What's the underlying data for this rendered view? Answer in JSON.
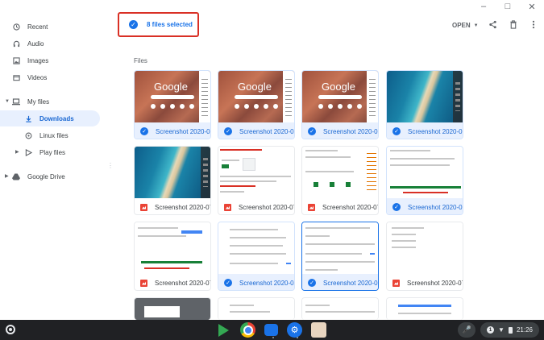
{
  "window": {
    "minimize": "–",
    "maximize": "□",
    "close": "✕"
  },
  "sidebar": {
    "items": [
      {
        "label": "Recent",
        "icon": "clock-icon"
      },
      {
        "label": "Audio",
        "icon": "headphones-icon"
      },
      {
        "label": "Images",
        "icon": "image-icon"
      },
      {
        "label": "Videos",
        "icon": "video-icon"
      },
      {
        "label": "My files",
        "icon": "laptop-icon"
      },
      {
        "label": "Downloads",
        "icon": "download-icon",
        "active": true
      },
      {
        "label": "Linux files",
        "icon": "linux-icon"
      },
      {
        "label": "Play files",
        "icon": "play-icon"
      },
      {
        "label": "Google Drive",
        "icon": "drive-icon"
      }
    ]
  },
  "header": {
    "selection_text": "8 files selected",
    "open_label": "OPEN",
    "accent": "#1a73e8",
    "highlight": "#d93025"
  },
  "section": {
    "title": "Files"
  },
  "files": [
    {
      "name": "Screenshot 2020-07...",
      "selected": true
    },
    {
      "name": "Screenshot 2020-07...",
      "selected": true
    },
    {
      "name": "Screenshot 2020-07...",
      "selected": true
    },
    {
      "name": "Screenshot 2020-07...",
      "selected": true
    },
    {
      "name": "Screenshot 2020-07...",
      "selected": false
    },
    {
      "name": "Screenshot 2020-07...",
      "selected": false
    },
    {
      "name": "Screenshot 2020-07...",
      "selected": false
    },
    {
      "name": "Screenshot 2020-07...",
      "selected": true
    },
    {
      "name": "Screenshot 2020-07...",
      "selected": false
    },
    {
      "name": "Screenshot 2020-07...",
      "selected": true
    },
    {
      "name": "Screenshot 2020-07...",
      "selected": true
    },
    {
      "name": "Screenshot 2020-07...",
      "selected": false
    }
  ],
  "thumbnails": {
    "google_logo": "Google"
  },
  "tray": {
    "time": "21:26",
    "notification_count": "1"
  }
}
